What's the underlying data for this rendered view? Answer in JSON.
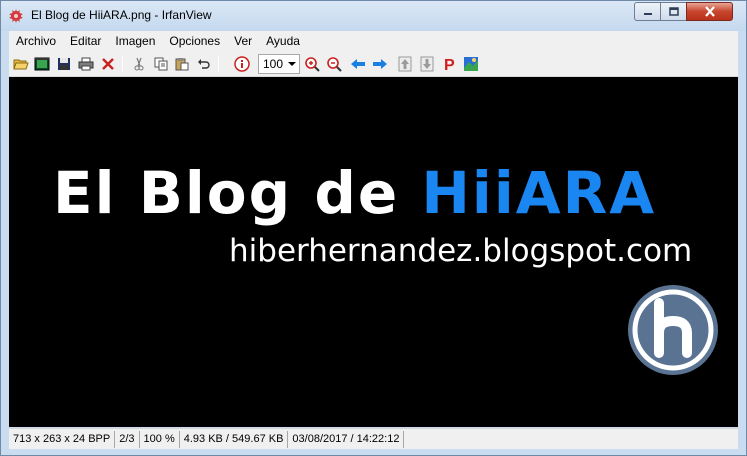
{
  "window": {
    "title": "El Blog de HiiARA.png - IrfanView",
    "buttons": [
      "minimize",
      "maximize",
      "close"
    ]
  },
  "menu": {
    "items": [
      "Archivo",
      "Editar",
      "Imagen",
      "Opciones",
      "Ver",
      "Ayuda"
    ]
  },
  "toolbar": {
    "zoom_value": "100",
    "icons": [
      "open-folder-icon",
      "slideshow-icon",
      "save-icon",
      "print-icon",
      "delete-icon",
      "cut-icon",
      "copy-icon",
      "paste-icon",
      "undo-icon",
      "info-icon",
      "zoom-in-icon",
      "zoom-out-icon",
      "previous-icon",
      "next-icon",
      "first-page-icon",
      "last-page-icon",
      "paint-icon",
      "thumbnails-icon"
    ]
  },
  "image": {
    "title_part1": "El Blog de ",
    "title_part2": "HiiARA",
    "url": "hiberhernandez.blogspot.com",
    "logo_letter": "h",
    "colors": {
      "background": "#000000",
      "text": "#ffffff",
      "accent": "#1a86f2",
      "logo": "#5a7393"
    }
  },
  "status": {
    "dimensions": "713 x 263 x 24 BPP",
    "index": "2/3",
    "zoom": "100 %",
    "size": "4.93 KB / 549.67 KB",
    "datetime": "03/08/2017 / 14:22:12"
  }
}
